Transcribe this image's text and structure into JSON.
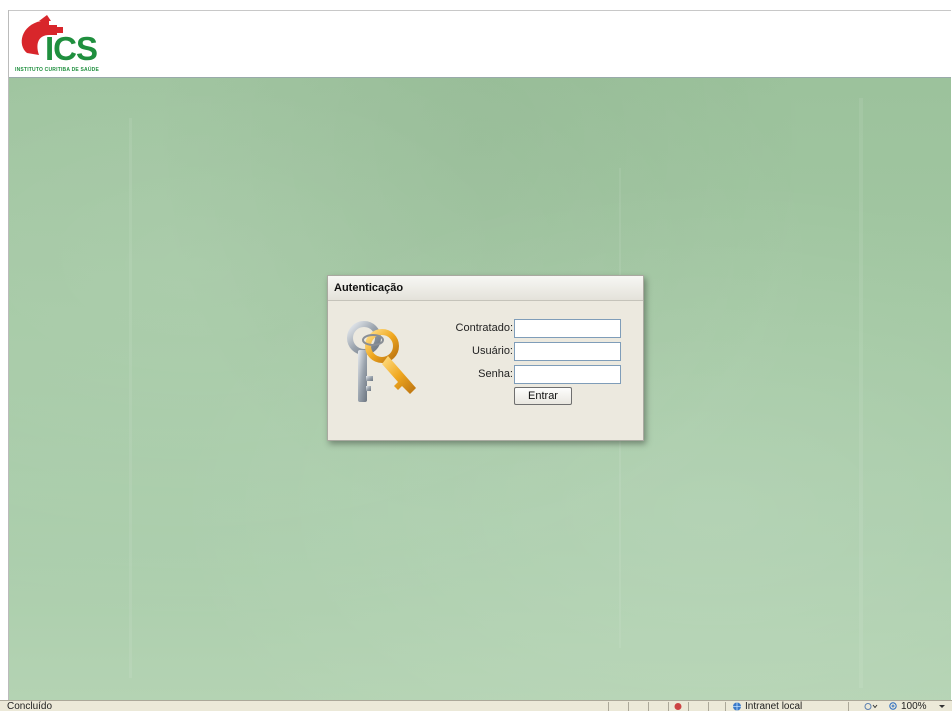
{
  "header": {
    "logo_text": "ICS",
    "logo_subtitle": "INSTITUTO CURITIBA DE SAÚDE"
  },
  "login": {
    "title": "Autenticação",
    "fields": [
      {
        "label": "Contratado:",
        "value": ""
      },
      {
        "label": "Usuário:",
        "value": ""
      },
      {
        "label": "Senha:",
        "value": ""
      }
    ],
    "submit_label": "Entrar"
  },
  "statusbar": {
    "status": "Concluído",
    "zone": "Intranet local",
    "zoom": "100%"
  },
  "colors": {
    "brand_red": "#d8262b",
    "brand_green": "#1f8f3e",
    "background_green": "#a3c8a3",
    "dialog_bg": "#ece9df"
  },
  "icons": [
    "ics-logo",
    "keys-icon",
    "intranet-globe-icon",
    "zoom-icon"
  ]
}
